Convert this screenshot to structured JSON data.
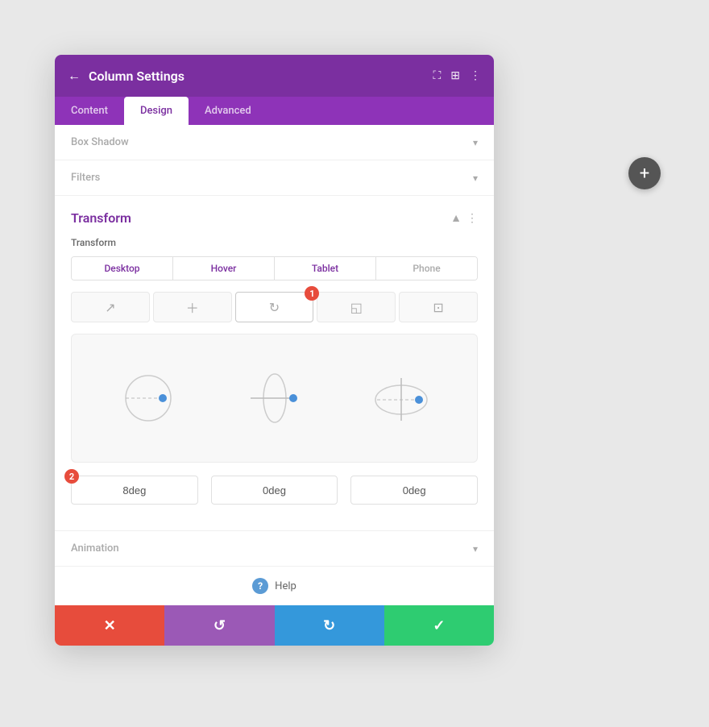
{
  "header": {
    "back_icon": "←",
    "title": "Column Settings",
    "icon_expand": "⛶",
    "icon_columns": "⊞",
    "icon_more": "⋮"
  },
  "tabs": [
    {
      "label": "Content",
      "active": false
    },
    {
      "label": "Design",
      "active": true
    },
    {
      "label": "Advanced",
      "active": false
    }
  ],
  "sections": {
    "box_shadow": {
      "label": "Box Shadow"
    },
    "filters": {
      "label": "Filters"
    },
    "transform": {
      "label": "Transform",
      "sub_label": "Transform",
      "device_tabs": [
        "Desktop",
        "Hover",
        "Tablet",
        "Phone"
      ],
      "badge1": "1",
      "badge2": "2",
      "degree_values": [
        "8deg",
        "0deg",
        "0deg"
      ]
    },
    "animation": {
      "label": "Animation"
    }
  },
  "help": {
    "label": "Help"
  },
  "bottom_bar": {
    "cancel": "✕",
    "undo": "↺",
    "redo": "↻",
    "save": "✓"
  },
  "fab": "+"
}
